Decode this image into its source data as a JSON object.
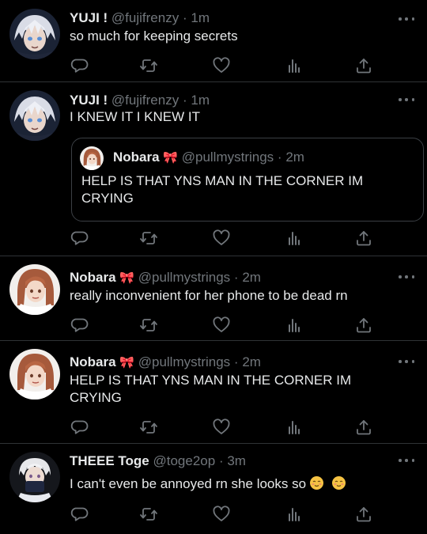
{
  "tweets": [
    {
      "name": "YUJI !",
      "handle": "@fujifrenzy",
      "time": "1m",
      "text": "so much for keeping secrets",
      "avatar": "gojo-avatar"
    },
    {
      "name": "YUJI !",
      "handle": "@fujifrenzy",
      "time": "1m",
      "text": "I KNEW IT I KNEW IT",
      "avatar": "gojo-avatar",
      "quote": {
        "name": "Nobara",
        "handle": "@pullmystrings",
        "time": "2m",
        "text": "HELP IS THAT YNS MAN IN THE CORNER IM CRYING",
        "avatar": "nobara-avatar"
      }
    },
    {
      "name": "Nobara",
      "handle": "@pullmystrings",
      "time": "2m",
      "text": "really inconvenient for her phone to be dead rn",
      "avatar": "nobara-avatar"
    },
    {
      "name": "Nobara",
      "handle": "@pullmystrings",
      "time": "2m",
      "text": "HELP IS THAT YNS MAN IN THE CORNER IM CRYING",
      "avatar": "nobara-avatar"
    },
    {
      "name": "THEEE Toge",
      "handle": "@toge2op",
      "time": "3m",
      "text": "I can't even be annoyed rn she looks so",
      "avatar": "toge-avatar",
      "trailing_emoji": [
        "relieved-face-emoji",
        "relieved-face-emoji"
      ]
    }
  ],
  "separator": "·",
  "name_emoji": "ribbon-emoji",
  "icons": [
    "reply-icon",
    "retweet-icon",
    "like-icon",
    "views-icon",
    "share-icon",
    "more-icon"
  ],
  "colors": {
    "background": "#000000",
    "text": "#e7e9ea",
    "muted": "#71767b",
    "border": "#2f3336",
    "ribbon": "#f2669e",
    "emoji": "#f6c343"
  }
}
